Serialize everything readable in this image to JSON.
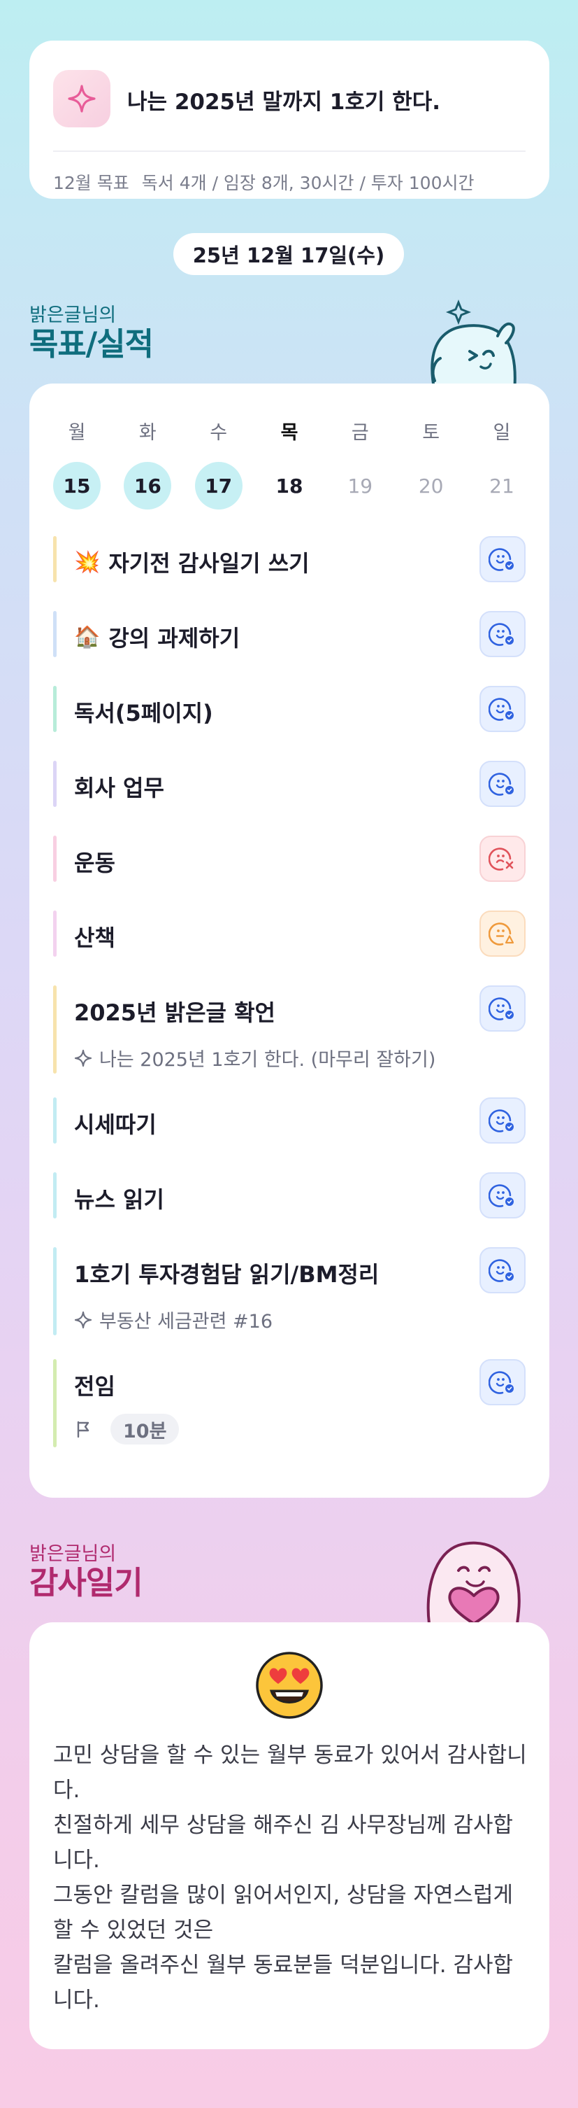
{
  "goal": {
    "title": "나는 2025년 말까지 1호기 한다.",
    "month_label": "12월 목표",
    "month_detail": "독서 4개 / 임장 8개, 30시간 / 투자 100시간"
  },
  "date": "25년 12월 17일(수)",
  "goals_section": {
    "owner": "밝은글님의",
    "title": "목표/실적"
  },
  "week": [
    {
      "day": "월",
      "date": "15",
      "state": "done"
    },
    {
      "day": "화",
      "date": "16",
      "state": "done"
    },
    {
      "day": "수",
      "date": "17",
      "state": "done"
    },
    {
      "day": "목",
      "date": "18",
      "state": "current"
    },
    {
      "day": "금",
      "date": "19",
      "state": "future"
    },
    {
      "day": "토",
      "date": "20",
      "state": "future"
    },
    {
      "day": "일",
      "date": "21",
      "state": "future"
    }
  ],
  "tasks": [
    {
      "emoji": "💥",
      "name": "자기전 감사일기 쓰기",
      "status": "good",
      "bar_color": "#f7e3ad"
    },
    {
      "emoji": "🏠",
      "name": "강의 과제하기",
      "status": "good",
      "bar_color": "#cfe0f7"
    },
    {
      "emoji": "",
      "name": "독서(5페이지)",
      "status": "good",
      "bar_color": "#b7ecd9"
    },
    {
      "emoji": "",
      "name": "회사 업무",
      "status": "good",
      "bar_color": "#dcd5f6"
    },
    {
      "emoji": "",
      "name": "운동",
      "status": "bad",
      "bar_color": "#f8cfe2"
    },
    {
      "emoji": "",
      "name": "산책",
      "status": "warn",
      "bar_color": "#f3d2ef"
    },
    {
      "emoji": "",
      "name": "2025년 밝은글 확언",
      "status": "good",
      "bar_color": "#f7e3ad",
      "sub": "나는 2025년 1호기 한다. (마무리 잘하기)"
    },
    {
      "emoji": "",
      "name": "시세따기",
      "status": "good",
      "bar_color": "#c2ecf3"
    },
    {
      "emoji": "",
      "name": "뉴스 읽기",
      "status": "good",
      "bar_color": "#c2ecf3"
    },
    {
      "emoji": "",
      "name": "1호기 투자경험담 읽기/BM정리",
      "status": "good",
      "bar_color": "#c2ecf3",
      "sub": "부동산 세금관련 #16"
    },
    {
      "emoji": "",
      "name": "전임",
      "status": "good",
      "bar_color": "#d4ecb0",
      "time": "10분"
    }
  ],
  "diary_section": {
    "owner": "밝은글님의",
    "title": "감사일기"
  },
  "diary": {
    "emoji": "heart-eyes-face",
    "lines": [
      "고민 상담을 할 수 있는 월부 동료가 있어서 감사합니다.",
      "친절하게 세무 상담을 해주신 김 사무장님께 감사합니다.",
      "그동안 칼럼을 많이 읽어서인지, 상담을 자연스럽게 할 수 있었던 것은",
      "칼럼을 올려주신 월부 동료분들 덕분입니다. 감사합니다."
    ]
  },
  "colors": {
    "good": "#2f62e0",
    "bad": "#e0525a",
    "warn": "#ef9a3c",
    "goals_title": "#0f6d7d",
    "diary_title": "#b02a6e"
  }
}
